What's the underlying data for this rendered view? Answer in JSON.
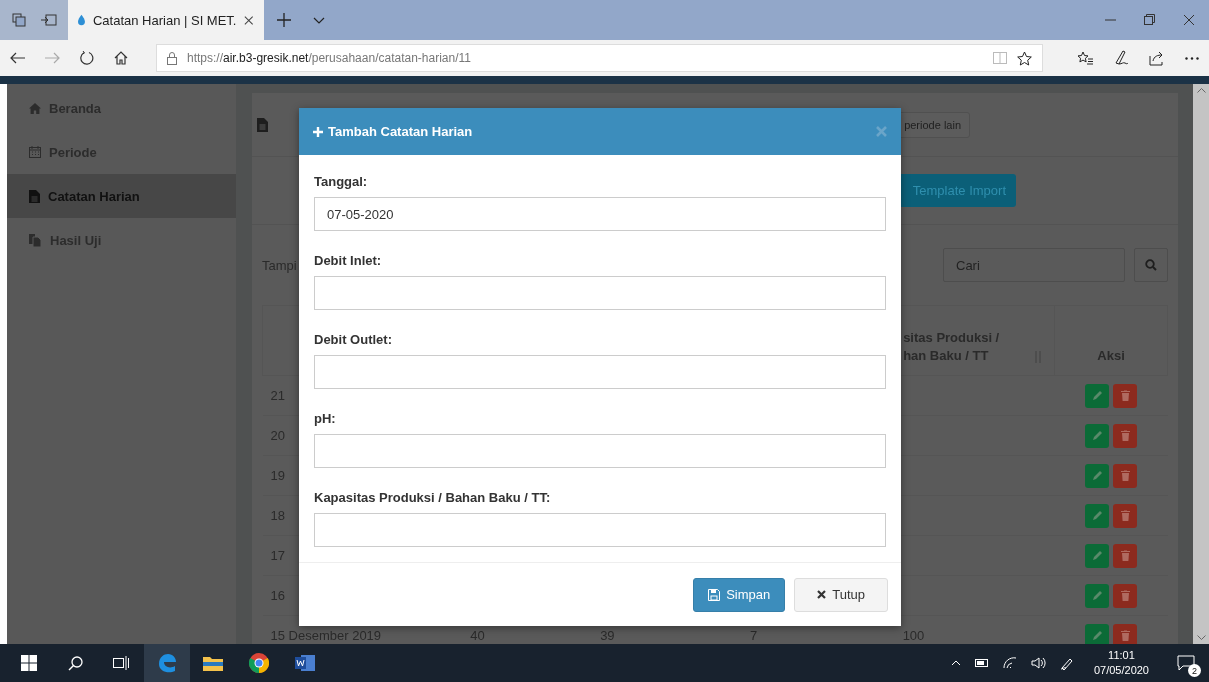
{
  "browser": {
    "tab_title": "Catatan Harian | SI MET.",
    "url_host": "https://air.b3-gresik.net",
    "url_path": "/perusahaan/catatan-harian/11"
  },
  "sidebar": {
    "items": [
      {
        "label": "Beranda",
        "selected": false
      },
      {
        "label": "Periode",
        "selected": false
      },
      {
        "label": "Catatan Harian",
        "selected": true
      },
      {
        "label": "Hasil Uji",
        "selected": false
      }
    ]
  },
  "page": {
    "other_period_button": "periode lain",
    "template_button": "Template Import",
    "show_label": "Tampi",
    "search": {
      "placeholder": "Cari"
    },
    "table": {
      "columns": [
        {},
        {},
        {},
        {},
        {
          "lines": [
            "sitas Produksi /",
            "han Baku / TT"
          ],
          "sortable": true
        },
        {
          "lines": [
            "Aksi"
          ]
        }
      ],
      "rows": [
        {
          "cells": [
            "21"
          ]
        },
        {
          "cells": [
            "20"
          ]
        },
        {
          "cells": [
            "19"
          ]
        },
        {
          "cells": [
            "18"
          ]
        },
        {
          "cells": [
            "17"
          ]
        },
        {
          "cells": [
            "16"
          ]
        },
        {
          "cells": [
            "15 Desember 2019",
            "40",
            "39",
            "7",
            "100"
          ]
        }
      ]
    }
  },
  "modal": {
    "title": "Tambah Catatan Harian",
    "fields": [
      {
        "label": "Tanggal:",
        "value": "07-05-2020"
      },
      {
        "label": "Debit Inlet:"
      },
      {
        "label": "Debit Outlet:"
      },
      {
        "label": "pH:"
      },
      {
        "label": "Kapasitas Produksi / Bahan Baku / TT:"
      }
    ],
    "save_button": "Simpan",
    "close_button": "Tutup"
  },
  "taskbar": {
    "time": "11:01",
    "date": "07/05/2020",
    "notifications": "2"
  }
}
